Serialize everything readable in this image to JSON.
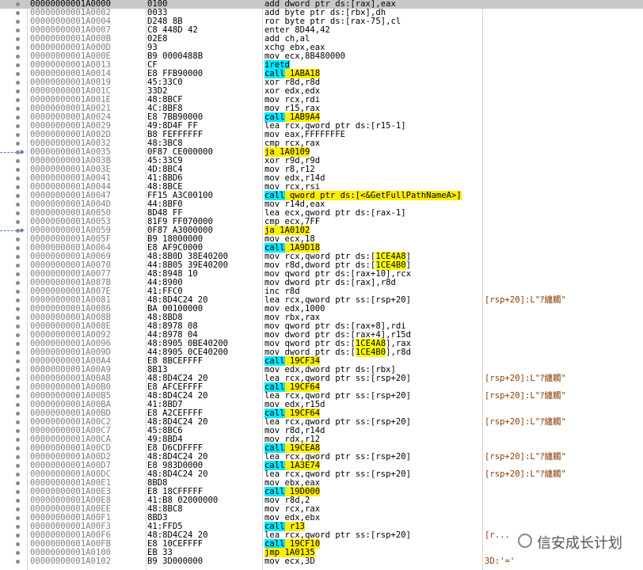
{
  "rows": [
    {
      "addr": "00000000001A0000",
      "bytes": "0100",
      "instr": "add dword ptr ds:[rax],eax",
      "selected": true
    },
    {
      "addr": "00000000001A0002",
      "bytes": "0033",
      "instr": "add byte ptr ds:[rbx],dh"
    },
    {
      "addr": "00000000001A0004",
      "bytes": "D248 8B",
      "instr": "ror byte ptr ds:[rax-75],cl"
    },
    {
      "addr": "00000000001A0007",
      "bytes": "C8 448D 42",
      "instr": "enter 8D44,42"
    },
    {
      "addr": "00000000001A000B",
      "bytes": "02E8",
      "instr": "add ch,al"
    },
    {
      "addr": "00000000001A000D",
      "bytes": "93",
      "instr": "xchg ebx,eax"
    },
    {
      "addr": "00000000001A000E",
      "bytes": "B9 0000488B",
      "instr": "mov ecx,8B480000"
    },
    {
      "addr": "00000000001A0013",
      "bytes": "CF",
      "instr": "iretd",
      "hl": "ret"
    },
    {
      "addr": "00000000001A0014",
      "bytes": "E8 FFB90000",
      "instr": "call 1ABA18",
      "hl": "call"
    },
    {
      "addr": "00000000001A0019",
      "bytes": "45:33C0",
      "instr": "xor r8d,r8d"
    },
    {
      "addr": "00000000001A001C",
      "bytes": "33D2",
      "instr": "xor edx,edx"
    },
    {
      "addr": "00000000001A001E",
      "bytes": "48:8BCF",
      "instr": "mov rcx,rdi"
    },
    {
      "addr": "00000000001A0021",
      "bytes": "4C:8BF8",
      "instr": "mov r15,rax"
    },
    {
      "addr": "00000000001A0024",
      "bytes": "E8 7BB90000",
      "instr": "call 1AB9A4",
      "hl": "call"
    },
    {
      "addr": "00000000001A0029",
      "bytes": "49:8D4F FF",
      "instr": "lea rcx,qword ptr ds:[r15-1]"
    },
    {
      "addr": "00000000001A002D",
      "bytes": "B8 FEFFFFFF",
      "instr": "mov eax,FFFFFFFE"
    },
    {
      "addr": "00000000001A0032",
      "bytes": "48:3BC8",
      "instr": "cmp rcx,rax"
    },
    {
      "addr": "00000000001A0035",
      "bytes": "0F87 CE000000",
      "instr": "ja 1A0109",
      "hl": "jmp",
      "arrow": true
    },
    {
      "addr": "00000000001A003B",
      "bytes": "45:33C9",
      "instr": "xor r9d,r9d"
    },
    {
      "addr": "00000000001A003E",
      "bytes": "4D:8BC4",
      "instr": "mov r8,r12"
    },
    {
      "addr": "00000000001A0041",
      "bytes": "41:8BD6",
      "instr": "mov edx,r14d"
    },
    {
      "addr": "00000000001A0044",
      "bytes": "48:8BCE",
      "instr": "mov rcx,rsi"
    },
    {
      "addr": "00000000001A0047",
      "bytes": "FF15 A3C00100",
      "instr": "call qword ptr ds:[<&GetFullPathNameA>]",
      "hl": "call"
    },
    {
      "addr": "00000000001A004D",
      "bytes": "44:8BF0",
      "instr": "mov r14d,eax"
    },
    {
      "addr": "00000000001A0050",
      "bytes": "8D48 FF",
      "instr": "lea ecx,qword ptr ds:[rax-1]"
    },
    {
      "addr": "00000000001A0053",
      "bytes": "81F9 FF070000",
      "instr": "cmp ecx,7FF"
    },
    {
      "addr": "00000000001A0059",
      "bytes": "0F87 A3000000",
      "instr": "ja 1A0102",
      "hl": "jmp",
      "arrow": true
    },
    {
      "addr": "00000000001A005F",
      "bytes": "B9 18000000",
      "instr": "mov ecx,18"
    },
    {
      "addr": "00000000001A0064",
      "bytes": "E8 AF9C0000",
      "instr": "call 1A9D18",
      "hl": "call"
    },
    {
      "addr": "00000000001A0069",
      "bytes": "48:8B0D 38E40200",
      "instr": "mov rcx,qword ptr ds:[1CE4A8]",
      "tgt": "1CE4A8"
    },
    {
      "addr": "00000000001A0070",
      "bytes": "44:8B05 39E40200",
      "instr": "mov r8d,dword ptr ds:[1CE4B0]",
      "tgt": "1CE4B0"
    },
    {
      "addr": "00000000001A0077",
      "bytes": "48:8948 10",
      "instr": "mov qword ptr ds:[rax+10],rcx"
    },
    {
      "addr": "00000000001A007B",
      "bytes": "44:8900",
      "instr": "mov dword ptr ds:[rax],r8d"
    },
    {
      "addr": "00000000001A007E",
      "bytes": "41:FFC0",
      "instr": "inc r8d"
    },
    {
      "addr": "00000000001A0081",
      "bytes": "48:8D4C24 20",
      "instr": "lea rcx,qword ptr ss:[rsp+20]",
      "comment": "[rsp+20]:L\"ｱ纏觸\""
    },
    {
      "addr": "00000000001A0086",
      "bytes": "BA 00100000",
      "instr": "mov edx,1000"
    },
    {
      "addr": "00000000001A008B",
      "bytes": "48:8BD8",
      "instr": "mov rbx,rax"
    },
    {
      "addr": "00000000001A008E",
      "bytes": "48:8978 08",
      "instr": "mov qword ptr ds:[rax+8],rdi"
    },
    {
      "addr": "00000000001A0092",
      "bytes": "44:8978 04",
      "instr": "mov dword ptr ds:[rax+4],r15d"
    },
    {
      "addr": "00000000001A0096",
      "bytes": "48:8905 0BE40200",
      "instr": "mov qword ptr ds:[1CE4A8],rax",
      "tgt": "1CE4A8"
    },
    {
      "addr": "00000000001A009D",
      "bytes": "44:8905 0CE40200",
      "instr": "mov dword ptr ds:[1CE4B0],r8d",
      "tgt": "1CE4B0"
    },
    {
      "addr": "00000000001A00A4",
      "bytes": "E8 8BCEFFFF",
      "instr": "call 19CF34",
      "hl": "call"
    },
    {
      "addr": "00000000001A00A9",
      "bytes": "8B13",
      "instr": "mov edx,dword ptr ds:[rbx]"
    },
    {
      "addr": "00000000001A00AB",
      "bytes": "48:8D4C24 20",
      "instr": "lea rcx,qword ptr ss:[rsp+20]",
      "comment": "[rsp+20]:L\"ｱ纏觸\""
    },
    {
      "addr": "00000000001A00B0",
      "bytes": "E8 AFCEFFFF",
      "instr": "call 19CF64",
      "hl": "call"
    },
    {
      "addr": "00000000001A00B5",
      "bytes": "48:8D4C24 20",
      "instr": "lea rcx,qword ptr ss:[rsp+20]",
      "comment": "[rsp+20]:L\"ｱ纏觸\""
    },
    {
      "addr": "00000000001A00BA",
      "bytes": "41:8BD7",
      "instr": "mov edx,r15d"
    },
    {
      "addr": "00000000001A00BD",
      "bytes": "E8 A2CEFFFF",
      "instr": "call 19CF64",
      "hl": "call"
    },
    {
      "addr": "00000000001A00C2",
      "bytes": "48:8D4C24 20",
      "instr": "lea rcx,qword ptr ss:[rsp+20]",
      "comment": "[rsp+20]:L\"ｱ纏觸\""
    },
    {
      "addr": "00000000001A00C7",
      "bytes": "45:8BC6",
      "instr": "mov r8d,r14d"
    },
    {
      "addr": "00000000001A00CA",
      "bytes": "49:8BD4",
      "instr": "mov rdx,r12"
    },
    {
      "addr": "00000000001A00CD",
      "bytes": "E8 D6CDFFFF",
      "instr": "call 19CEA8",
      "hl": "call"
    },
    {
      "addr": "00000000001A00D2",
      "bytes": "48:8D4C24 20",
      "instr": "lea rcx,qword ptr ss:[rsp+20]",
      "comment": "[rsp+20]:L\"ｱ纏觸\""
    },
    {
      "addr": "00000000001A00D7",
      "bytes": "E8 983D0000",
      "instr": "call 1A3E74",
      "hl": "call"
    },
    {
      "addr": "00000000001A00DC",
      "bytes": "48:8D4C24 20",
      "instr": "lea rcx,qword ptr ss:[rsp+20]",
      "comment": "[rsp+20]:L\"ｱ纏觸\""
    },
    {
      "addr": "00000000001A00E1",
      "bytes": "8BD8",
      "instr": "mov ebx,eax"
    },
    {
      "addr": "00000000001A00E3",
      "bytes": "E8 18CFFFFF",
      "instr": "call 19D000",
      "hl": "call"
    },
    {
      "addr": "00000000001A00E8",
      "bytes": "41:B8 02000000",
      "instr": "mov r8d,2"
    },
    {
      "addr": "00000000001A00EE",
      "bytes": "48:8BC8",
      "instr": "mov rcx,rax"
    },
    {
      "addr": "00000000001A00F1",
      "bytes": "8BD3",
      "instr": "mov edx,ebx"
    },
    {
      "addr": "00000000001A00F3",
      "bytes": "41:FFD5",
      "instr": "call r13",
      "hl": "call"
    },
    {
      "addr": "00000000001A00F6",
      "bytes": "48:8D4C24 20",
      "instr": "lea rcx,qword ptr ss:[rsp+20]",
      "comment": "[r..."
    },
    {
      "addr": "00000000001A00FB",
      "bytes": "E8 10CEFFFF",
      "instr": "call 19CF10",
      "hl": "call"
    },
    {
      "addr": "00000000001A0100",
      "bytes": "EB 33",
      "instr": "jmp 1A0135",
      "hl": "jmp"
    },
    {
      "addr": "00000000001A0102",
      "bytes": "B9 3D000000",
      "instr": "mov ecx,3D",
      "comment": "3D:'='"
    }
  ],
  "watermark": "信安成长计划"
}
